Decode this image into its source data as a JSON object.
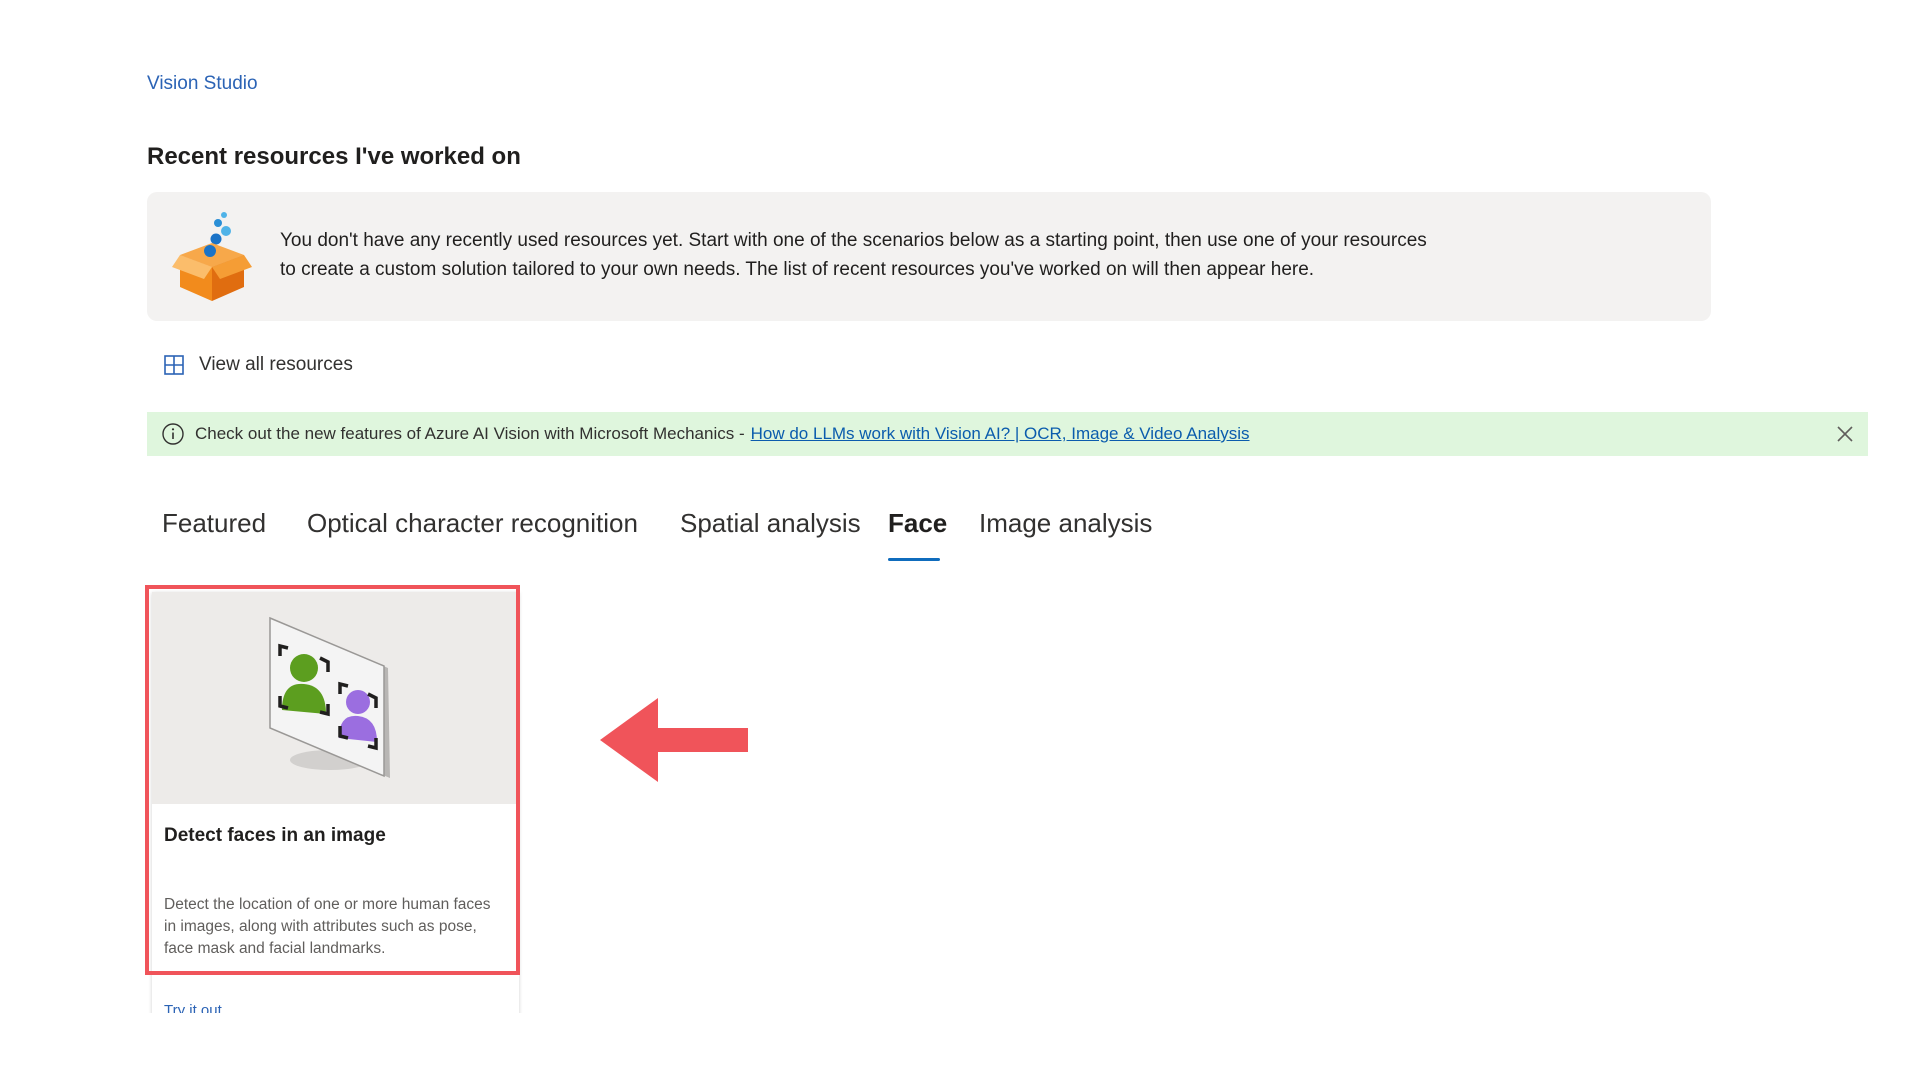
{
  "breadcrumb": {
    "label": "Vision Studio"
  },
  "recent": {
    "title": "Recent resources I've worked on",
    "empty_line1": "You don't have any recently used resources yet. Start with one of the scenarios below as a starting point, then use one of your resources",
    "empty_line2": "to create a custom solution tailored to your own needs. The list of recent resources you've worked on will then appear here.",
    "view_all_label": "View all resources"
  },
  "banner": {
    "message": "Check out the new features of Azure AI Vision with Microsoft Mechanics -",
    "link_text": "How do LLMs work with Vision AI? | OCR, Image & Video Analysis"
  },
  "tabs": [
    {
      "label": "Featured",
      "selected": false
    },
    {
      "label": "Optical character recognition",
      "selected": false
    },
    {
      "label": "Spatial analysis",
      "selected": false
    },
    {
      "label": "Face",
      "selected": true
    },
    {
      "label": "Image analysis",
      "selected": false
    }
  ],
  "card": {
    "title": "Detect faces in an image",
    "description": "Detect the location of one or more human faces in images, along with attributes such as pose, face mask and facial landmarks.",
    "link": "Try it out"
  },
  "colors": {
    "accent": "#0f6cbd",
    "link": "#2b63b5",
    "banner_bg": "#dff6dd",
    "highlight": "#f0545a",
    "face_green": "#5c9e1f",
    "face_purple": "#9b6ee0"
  },
  "icons": {
    "empty_state": "open-box-icon",
    "view_all": "grid-icon",
    "banner_info": "info-icon",
    "banner_close": "close-icon",
    "card_media": "face-detection-icon",
    "annotation": "left-arrow-icon"
  }
}
